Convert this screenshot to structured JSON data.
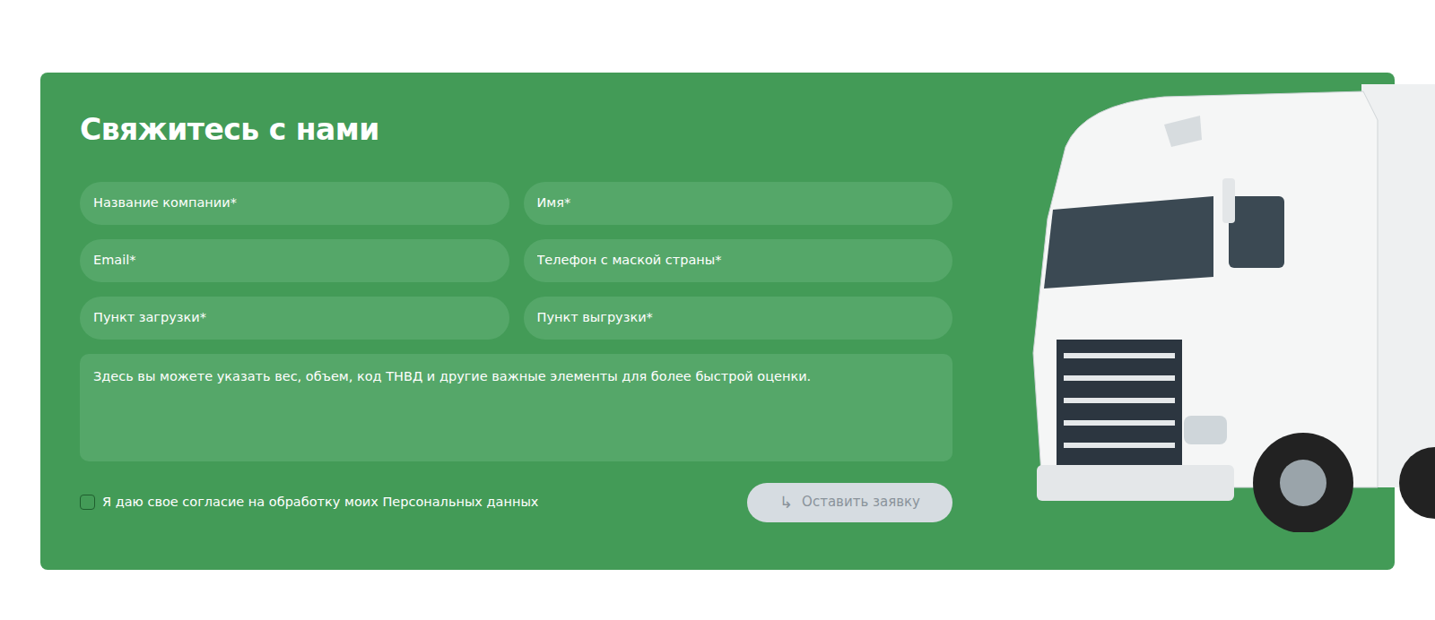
{
  "title": "Свяжитесь с нами",
  "fields": [
    {
      "placeholder": "Название компании*"
    },
    {
      "placeholder": "Имя*"
    },
    {
      "placeholder": "Email*"
    },
    {
      "placeholder": "Телефон с маской страны*"
    },
    {
      "placeholder": "Пункт загрузки*"
    },
    {
      "placeholder": "Пункт выгрузки*"
    }
  ],
  "message": {
    "placeholder": "Здесь вы можете указать вес, объем, код ТНВД и другие важные элементы для более быстрой оценки."
  },
  "consent": {
    "label": "Я даю свое согласие на обработку моих Персональных данных",
    "checked": false
  },
  "submit": {
    "icon": "↳",
    "label": "Оставить заявку",
    "disabled": true
  }
}
